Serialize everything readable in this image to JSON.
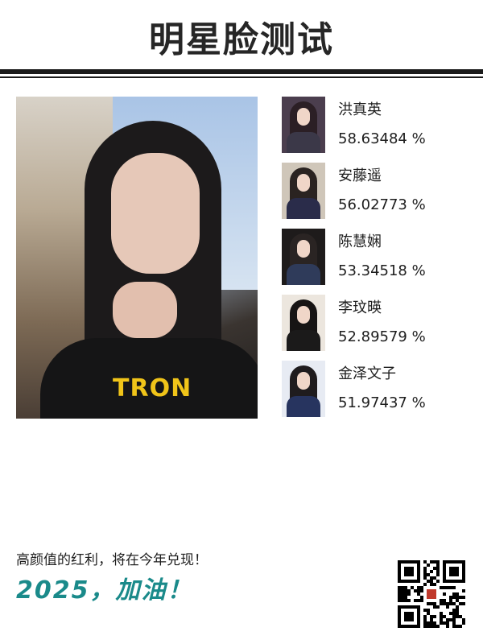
{
  "header": {
    "title": "明星脸测试"
  },
  "matches": [
    {
      "name": "洪真英",
      "score": "58.63484 %",
      "colors": {
        "bg": "#4b3e4e",
        "hair": "#2b1f25",
        "body": "#3b3848"
      }
    },
    {
      "name": "安藤遥",
      "score": "56.02773 %",
      "colors": {
        "bg": "#cfc6b9",
        "hair": "#2a2321",
        "body": "#2a2c4a"
      }
    },
    {
      "name": "陈慧娴",
      "score": "53.34518 %",
      "colors": {
        "bg": "#1e1b1b",
        "hair": "#2a2423",
        "body": "#2f3b5a"
      }
    },
    {
      "name": "李玟暎",
      "score": "52.89579 %",
      "colors": {
        "bg": "#ece6de",
        "hair": "#171414",
        "body": "#1b1a1a"
      }
    },
    {
      "name": "金泽文子",
      "score": "51.97437 %",
      "colors": {
        "bg": "#e7ebf3",
        "hair": "#1f1c1e",
        "body": "#27345f"
      }
    }
  ],
  "footer": {
    "slogan": "高颜值的红利，将在今年兑现！",
    "cheer": "2025，加油！"
  },
  "colors": {
    "accent": "#1a8a8a",
    "rule": "#1a1a1a"
  }
}
